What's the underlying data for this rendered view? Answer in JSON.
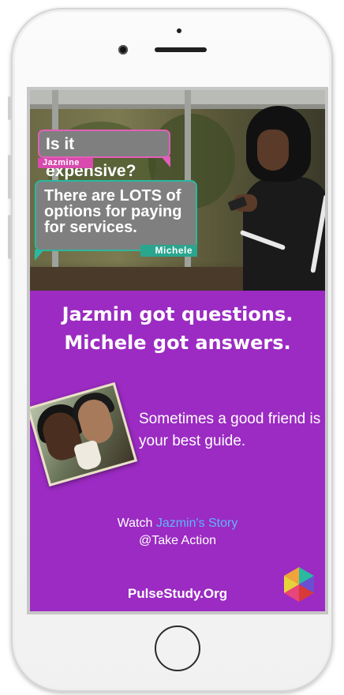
{
  "ad": {
    "bubble1": {
      "text": "Is it expensive?",
      "speaker": "Jazmine"
    },
    "bubble2": {
      "text": "There are LOTS of options for paying for services.",
      "speaker": "Michele"
    },
    "headline": [
      "Jazmin got questions.",
      "Michele got answers."
    ],
    "quote": "Sometimes a good friend is your best guide.",
    "watch": {
      "prefix": "Watch ",
      "link": "Jazmin's Story",
      "line2": "@Take Action"
    },
    "site": "PulseStudy.Org"
  },
  "colors": {
    "background_purple": "#9b2bc2",
    "bubble_gray": "#7f7f7f",
    "pink_accent": "#e15fb8",
    "teal_accent": "#2ab8a0",
    "link_blue": "#5fb4ff"
  }
}
